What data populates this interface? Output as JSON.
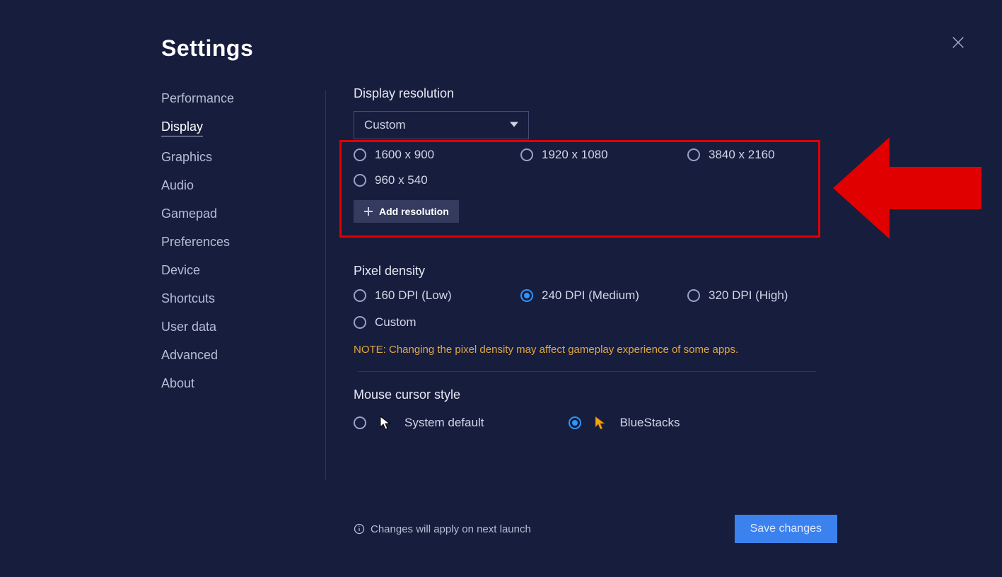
{
  "title": "Settings",
  "sidebar": {
    "items": [
      {
        "label": "Performance",
        "active": false
      },
      {
        "label": "Display",
        "active": true
      },
      {
        "label": "Graphics",
        "active": false
      },
      {
        "label": "Audio",
        "active": false
      },
      {
        "label": "Gamepad",
        "active": false
      },
      {
        "label": "Preferences",
        "active": false
      },
      {
        "label": "Device",
        "active": false
      },
      {
        "label": "Shortcuts",
        "active": false
      },
      {
        "label": "User data",
        "active": false
      },
      {
        "label": "Advanced",
        "active": false
      },
      {
        "label": "About",
        "active": false
      }
    ]
  },
  "display": {
    "resolution_label": "Display resolution",
    "select_value": "Custom",
    "resolutions": [
      {
        "label": "1600 x 900",
        "selected": false
      },
      {
        "label": "1920 x 1080",
        "selected": false
      },
      {
        "label": "3840 x 2160",
        "selected": false
      },
      {
        "label": "960 x 540",
        "selected": false
      }
    ],
    "add_resolution_label": "Add resolution"
  },
  "pixel_density": {
    "label": "Pixel density",
    "options": [
      {
        "label": "160 DPI (Low)",
        "selected": false
      },
      {
        "label": "240 DPI (Medium)",
        "selected": true
      },
      {
        "label": "320 DPI (High)",
        "selected": false
      },
      {
        "label": "Custom",
        "selected": false
      }
    ],
    "note": "NOTE: Changing the pixel density may affect gameplay experience of some apps."
  },
  "mouse": {
    "label": "Mouse cursor style",
    "options": [
      {
        "label": "System default",
        "selected": false,
        "icon": "system"
      },
      {
        "label": "BlueStacks",
        "selected": true,
        "icon": "bluestacks"
      }
    ]
  },
  "footer": {
    "note": "Changes will apply on next launch",
    "save_label": "Save changes"
  }
}
